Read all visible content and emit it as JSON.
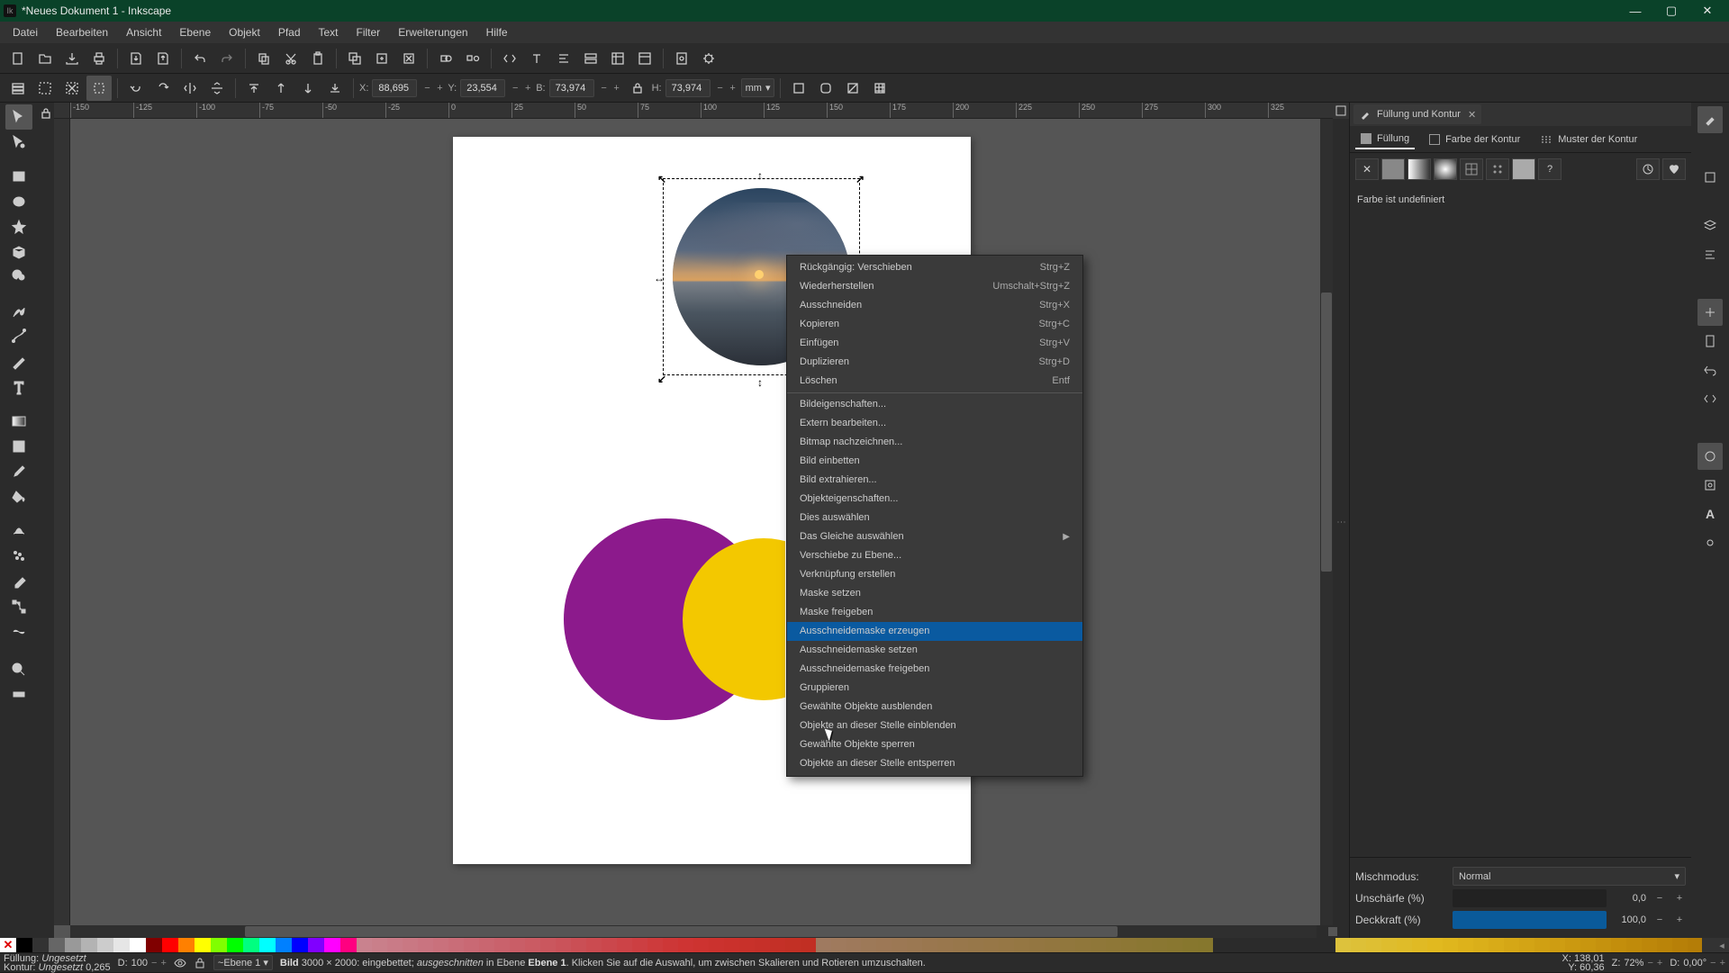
{
  "window": {
    "title": "*Neues Dokument 1 - Inkscape"
  },
  "menubar": [
    "Datei",
    "Bearbeiten",
    "Ansicht",
    "Ebene",
    "Objekt",
    "Pfad",
    "Text",
    "Filter",
    "Erweiterungen",
    "Hilfe"
  ],
  "toolbar2": {
    "x_label": "X:",
    "x_value": "88,695",
    "y_label": "Y:",
    "y_value": "23,554",
    "w_label": "B:",
    "w_value": "73,974",
    "h_label": "H:",
    "h_value": "73,974",
    "unit": "mm"
  },
  "ruler_ticks": [
    "-150",
    "-125",
    "-100",
    "-75",
    "-50",
    "-25",
    "0",
    "25",
    "50",
    "75",
    "100",
    "125",
    "150",
    "175",
    "200",
    "225",
    "250",
    "275",
    "300",
    "325"
  ],
  "context_menu": {
    "items": [
      {
        "label": "Rückgängig: Verschieben",
        "shortcut": "Strg+Z",
        "disabled": false
      },
      {
        "label": "Wiederherstellen",
        "shortcut": "Umschalt+Strg+Z",
        "disabled": false
      },
      {
        "label": "Ausschneiden",
        "shortcut": "Strg+X",
        "disabled": false
      },
      {
        "label": "Kopieren",
        "shortcut": "Strg+C",
        "disabled": false
      },
      {
        "label": "Einfügen",
        "shortcut": "Strg+V",
        "disabled": false
      },
      {
        "label": "Duplizieren",
        "shortcut": "Strg+D",
        "disabled": false
      },
      {
        "label": "Löschen",
        "shortcut": "Entf",
        "disabled": false
      },
      {
        "sep": true
      },
      {
        "label": "Bildeigenschaften...",
        "disabled": false
      },
      {
        "label": "Extern bearbeiten...",
        "disabled": true
      },
      {
        "label": "Bitmap nachzeichnen...",
        "disabled": false
      },
      {
        "label": "Bild einbetten",
        "disabled": true
      },
      {
        "label": "Bild extrahieren...",
        "disabled": false
      },
      {
        "label": "Objekteigenschaften...",
        "disabled": false
      },
      {
        "label": "Dies auswählen",
        "disabled": true
      },
      {
        "label": "Das Gleiche auswählen",
        "submenu": true,
        "disabled": false
      },
      {
        "label": "Verschiebe zu Ebene...",
        "disabled": false
      },
      {
        "label": "Verknüpfung erstellen",
        "disabled": false
      },
      {
        "label": "Maske setzen",
        "disabled": true
      },
      {
        "label": "Maske freigeben",
        "disabled": true
      },
      {
        "label": "Ausschneidemaske erzeugen",
        "disabled": false,
        "hl": true
      },
      {
        "label": "Ausschneidemaske setzen",
        "disabled": true
      },
      {
        "label": "Ausschneidemaske freigeben",
        "disabled": false
      },
      {
        "label": "Gruppieren",
        "disabled": false
      },
      {
        "label": "Gewählte Objekte ausblenden",
        "disabled": false
      },
      {
        "label": "Objekte an dieser Stelle einblenden",
        "disabled": true
      },
      {
        "label": "Gewählte Objekte sperren",
        "disabled": false
      },
      {
        "label": "Objekte an dieser Stelle entsperren",
        "disabled": true
      }
    ]
  },
  "panel": {
    "title": "Füllung und Kontur",
    "tabs": {
      "fill": "Füllung",
      "stroke": "Farbe der Kontur",
      "pattern": "Muster der Kontur"
    },
    "undefined_msg": "Farbe ist undefiniert",
    "blend_label": "Mischmodus:",
    "blend_value": "Normal",
    "blur_label": "Unschärfe (%)",
    "blur_value": "0,0",
    "opacity_label": "Deckkraft (%)",
    "opacity_value": "100,0",
    "swatches": {
      "unknown": "?"
    }
  },
  "status": {
    "fill_label": "Füllung:",
    "fill_value": "Ungesetzt",
    "stroke_label": "Kontur:",
    "stroke_value": "Ungesetzt",
    "stroke_w": "0,265",
    "opacity_label": "D:",
    "opacity_value": "100",
    "layer_prefix": "~Ebene 1",
    "msg_bolded": "Bild",
    "msg_dim": " 3000 × 2000: eingebettet; ",
    "msg_italic": "ausgeschnitten",
    "msg_rest": " in Ebene ",
    "msg_layer": "Ebene 1",
    "msg_tail": ". Klicken Sie auf die Auswahl, um zwischen Skalieren und Rotieren umzuschalten.",
    "coord_x_label": "X:",
    "coord_x": "138,01",
    "coord_y_label": "Y:",
    "coord_y": "60,36",
    "zoom_label": "Z:",
    "zoom": "72%",
    "rot_label": "D:",
    "rot": "0,00°"
  }
}
